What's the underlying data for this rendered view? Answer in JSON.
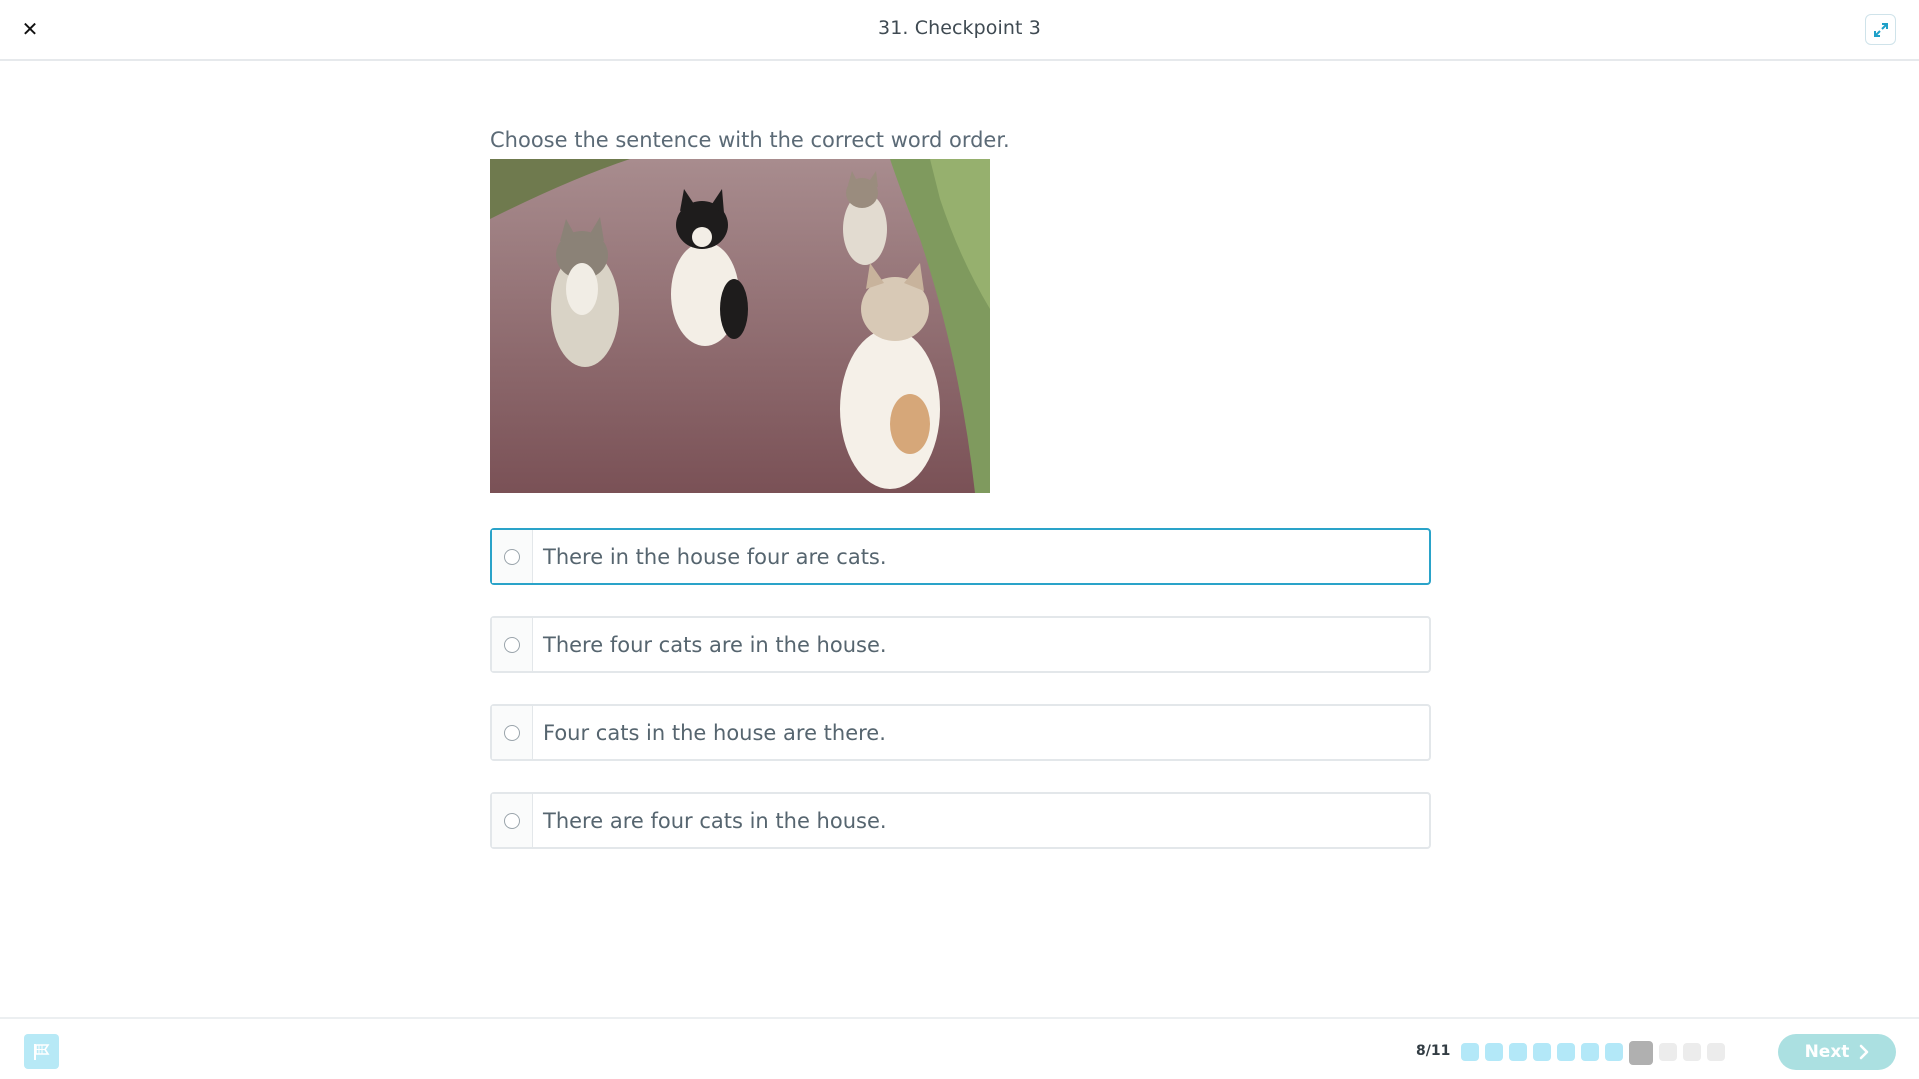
{
  "header": {
    "title": "31. Checkpoint 3",
    "close_icon": "close-icon",
    "expand_icon": "expand-icon"
  },
  "question": {
    "prompt": "Choose the sentence with the correct word order.",
    "image_icon": "cats-photo"
  },
  "options": [
    {
      "text": "There in the house four are cats.",
      "selected": false
    },
    {
      "text": "There four cats are in the house.",
      "selected": false
    },
    {
      "text": "Four cats in the house are there.",
      "selected": false
    },
    {
      "text": "There are four cats in the house.",
      "selected": false
    }
  ],
  "footer": {
    "flag_icon": "flag-icon",
    "progress_text": "8/11",
    "progress": {
      "current": 8,
      "total": 11
    },
    "next_label": "Next",
    "next_icon": "chevron-right-icon"
  },
  "colors": {
    "accent": "#2aa3c9",
    "step_done": "#b3e8f8",
    "step_current": "#b0b0b0",
    "step_todo": "#ececec",
    "next_button": "#abe0e1"
  }
}
